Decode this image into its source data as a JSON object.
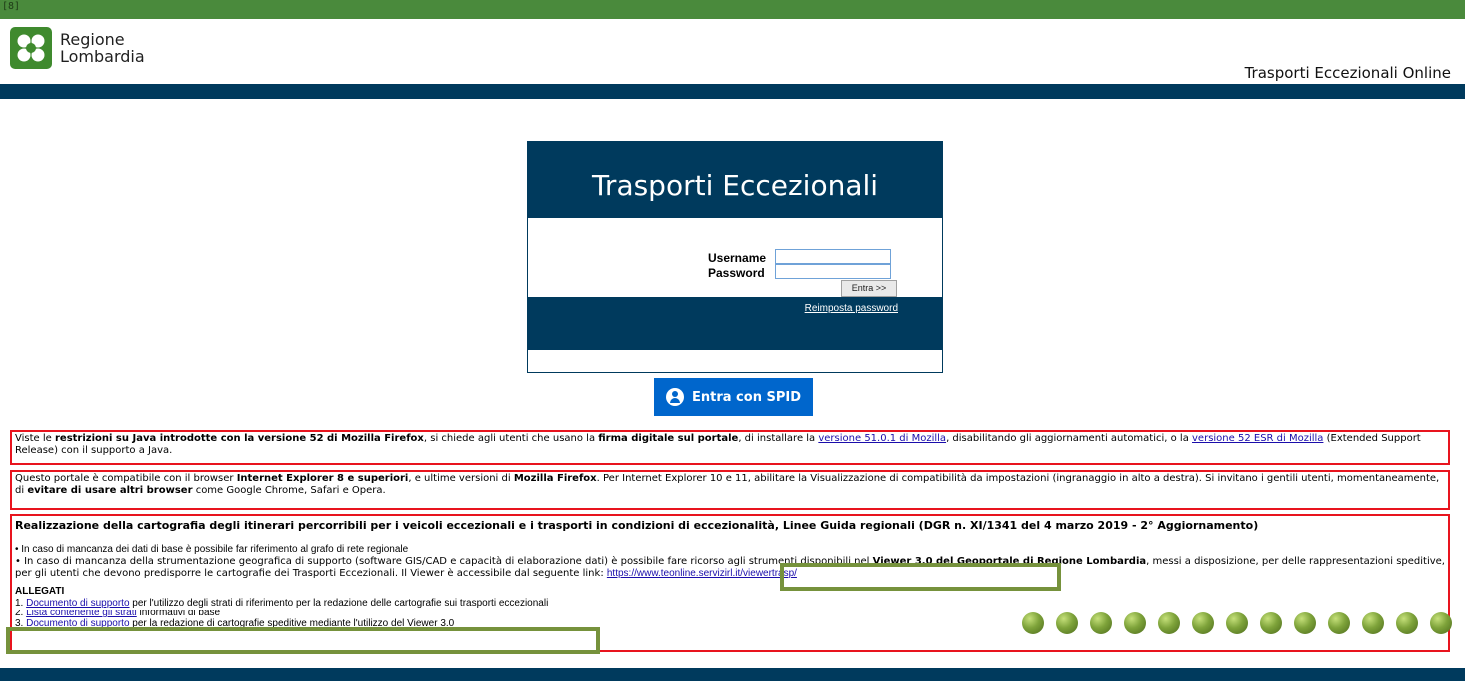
{
  "top": {
    "tag": "[8]"
  },
  "logo": {
    "line1": "Regione",
    "line2": "Lombardia"
  },
  "header": {
    "app_title": "Trasporti Eccezionali Online"
  },
  "login": {
    "title": "Trasporti Eccezionali",
    "username_label": "Username",
    "password_label": "Password",
    "username_value": "",
    "password_value": "",
    "submit_label": "Entra >>",
    "reset_link": "Reimposta password"
  },
  "spid": {
    "label": "Entra con SPID"
  },
  "notice1": {
    "t1": "Viste le ",
    "b1": "restrizioni su Java introdotte con la versione 52 di Mozilla Firefox",
    "t2": ", si chiede agli utenti che usano la ",
    "b2": "firma digitale sul portale",
    "t3": ", di installare la ",
    "link1": "versione 51.0.1 di Mozilla",
    "t4": ", disabilitando gli aggiornamenti automatici, o la ",
    "link2": "versione 52 ESR di Mozilla",
    "t5": " (Extended Support Release) con il supporto a Java."
  },
  "notice2": {
    "t1": "Questo portale è compatibile con il browser ",
    "b1": "Internet Explorer 8 e superiori",
    "t2": ", e ultime versioni di ",
    "b2": "Mozilla Firefox",
    "t3": ". Per Internet Explorer 10 e 11, abilitare la Visualizzazione di compatibilità da impostazioni (ingranaggio in alto a destra). Si invitano i gentili utenti, momentaneamente, di ",
    "b3": "evitare di usare altri browser",
    "t4": " come Google Chrome, Safari e Opera."
  },
  "notice3": {
    "title": "Realizzazione della cartografia degli itinerari percorribili per i veicoli eccezionali e i trasporti in condizioni di eccezionalità, Linee Guida regionali (DGR n. XI/1341 del 4 marzo 2019 - 2° Aggiornamento)",
    "bullet1": "• In caso di mancanza dei dati di base è possibile far riferimento al grafo di rete regionale",
    "bullet2_a": "• In caso di mancanza della strumentazione geografica di supporto (software GIS/CAD e capacità di elaborazione dati) è possibile fare ricorso agli strumenti disponibili nel ",
    "bullet2_b": "Viewer 3.0 del Geoportale di Regione Lombardia",
    "bullet2_c": ", messi a disposizione, per delle rappresentazioni speditive, per gli utenti che devono predisporre le cartografie dei Trasporti Eccezionali. Il Viewer è accessibile dal seguente link: ",
    "viewer_link": "https://www.teonline.servizirl.it/viewertrasp/",
    "allegati_title": "ALLEGATI",
    "a1_num": "1. ",
    "a1_link": "Documento di supporto",
    "a1_text": " per l'utilizzo degli strati di riferimento per la redazione delle cartografie sui trasporti eccezionali",
    "a2_num": "2. ",
    "a2_link": "Lista contenente gli strati",
    "a2_text": " informativi di base",
    "a3_num": "3. ",
    "a3_link": "Documento di supporto",
    "a3_text": " per la redazione di cartografie speditive mediante l'utilizzo del Viewer 3.0"
  },
  "colors": {
    "navy": "#003a5d",
    "green": "#4a8a3c",
    "notice_border": "#e8141e",
    "highlight": "#76923c",
    "spid_blue": "#0066cc"
  }
}
